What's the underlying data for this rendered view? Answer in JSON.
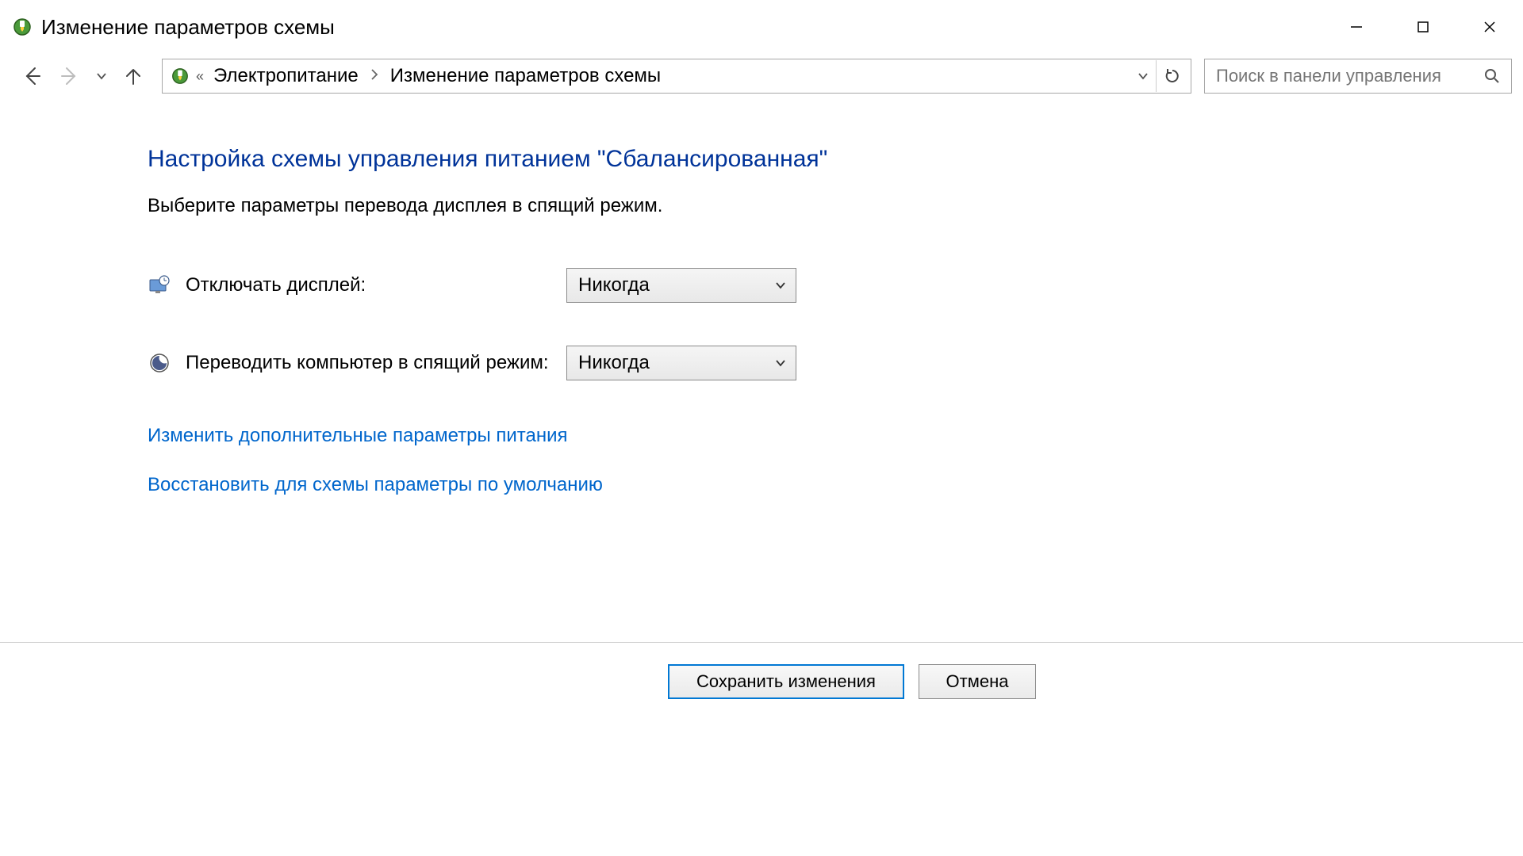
{
  "window": {
    "title": "Изменение параметров схемы"
  },
  "breadcrumb": {
    "item1": "Электропитание",
    "item2": "Изменение параметров схемы"
  },
  "search": {
    "placeholder": "Поиск в панели управления"
  },
  "page": {
    "title": "Настройка схемы управления питанием \"Сбалансированная\"",
    "subtitle": "Выберите параметры перевода дисплея в спящий режим."
  },
  "settings": {
    "display_off": {
      "label": "Отключать дисплей:",
      "value": "Никогда"
    },
    "sleep": {
      "label": "Переводить компьютер в спящий режим:",
      "value": "Никогда"
    }
  },
  "links": {
    "advanced": "Изменить дополнительные параметры питания",
    "restore": "Восстановить для схемы параметры по умолчанию"
  },
  "buttons": {
    "save": "Сохранить изменения",
    "cancel": "Отмена"
  }
}
